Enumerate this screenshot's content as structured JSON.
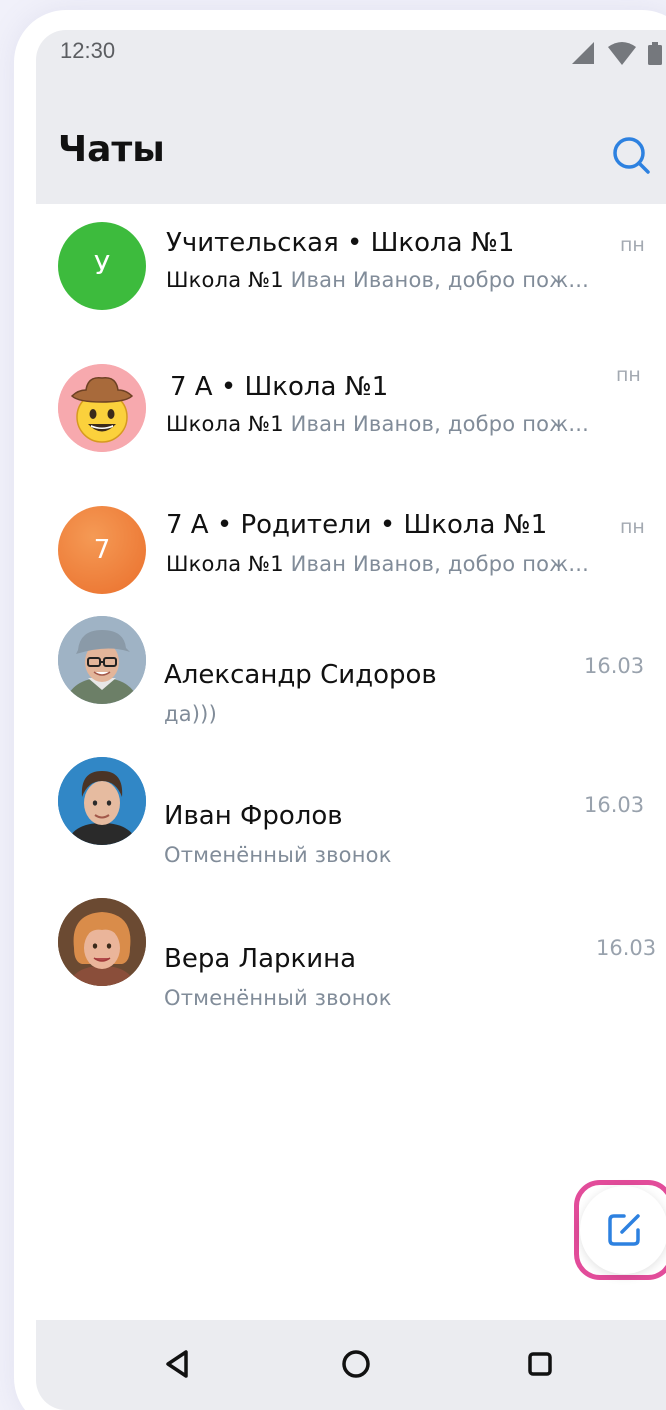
{
  "status_bar": {
    "time": "12:30"
  },
  "header": {
    "title": "Чаты"
  },
  "chats": [
    {
      "name": "Учительская • Школа №1",
      "sender": "Школа №1",
      "message": " Иван Иванов, добро пож...",
      "date": "пн",
      "avatar_letter": "У",
      "avatar_color": "#3dbb3d"
    },
    {
      "name": "7 А • Школа №1",
      "sender": "Школа №1",
      "message": " Иван Иванов, добро пож...",
      "date": "пн",
      "avatar_emoji": "🤠",
      "avatar_color": "#f7a9ae"
    },
    {
      "name": "7 А • Родители • Школа №1",
      "sender": "Школа №1",
      "message": " Иван Иванов, добро пож...",
      "date": "пн",
      "avatar_letter": "7",
      "avatar_color": "#ef7f39"
    },
    {
      "name": "Александр Сидоров",
      "message": "да)))",
      "date": "16.03"
    },
    {
      "name": "Иван Фролов",
      "message": "Отменённый звонок",
      "date": "16.03"
    },
    {
      "name": "Вера Ларкина",
      "message": "Отменённый звонок",
      "date": "16.03"
    }
  ],
  "colors": {
    "accent": "#2d81e0",
    "highlight": "#e24c9a",
    "header_bg": "#ebecf0"
  },
  "icons": [
    "search-icon",
    "compose-icon",
    "nav-back-icon",
    "nav-home-icon",
    "nav-recents-icon",
    "signal-icon",
    "wifi-icon",
    "battery-icon"
  ]
}
